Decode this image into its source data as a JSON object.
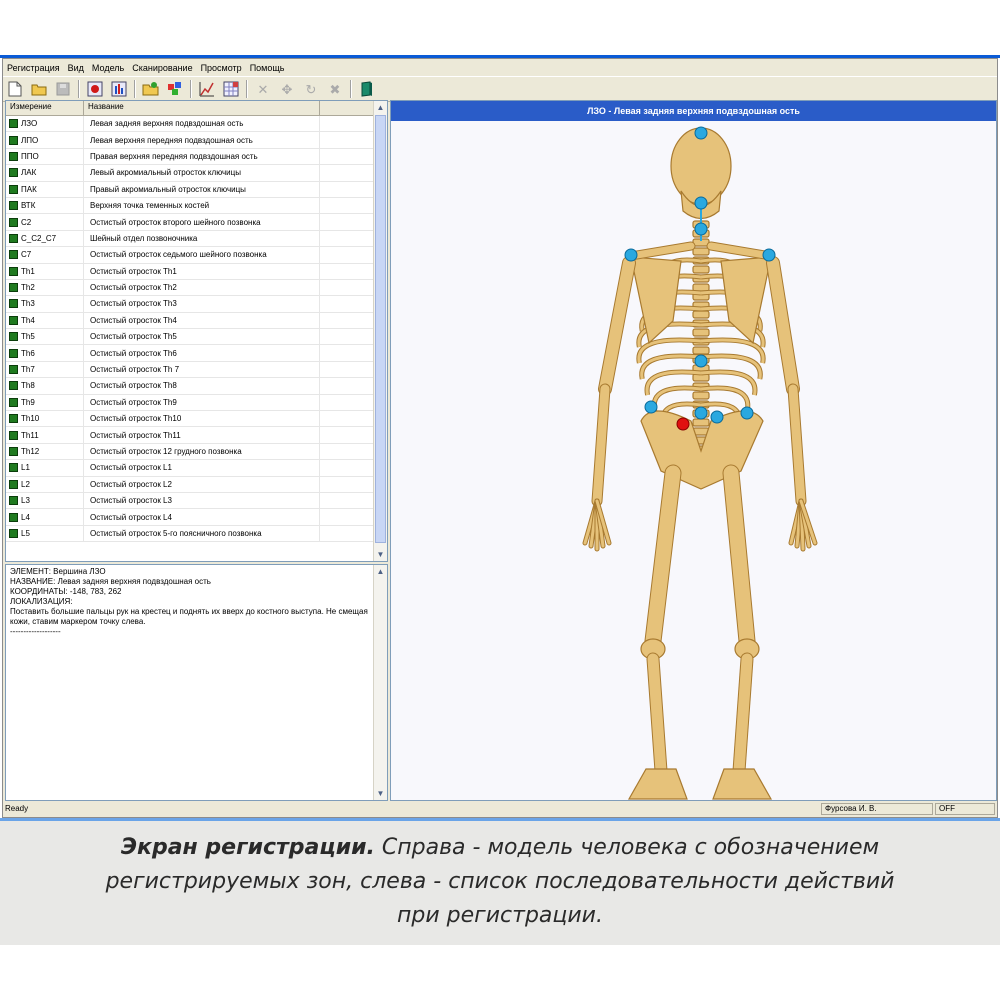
{
  "menu": [
    "Регистрация",
    "Вид",
    "Модель",
    "Сканирование",
    "Просмотр",
    "Помощь"
  ],
  "list": {
    "headers": [
      "Измерение",
      "Название"
    ],
    "rows": [
      [
        "ЛЗО",
        "Левая задняя верхняя подвздошная ость"
      ],
      [
        "ЛПО",
        "Левая верхняя передняя подвздошная ость"
      ],
      [
        "ППО",
        "Правая верхняя передняя подвздошная ость"
      ],
      [
        "ЛАК",
        "Левый акромиальный отросток  ключицы"
      ],
      [
        "ПАК",
        "Правый акромиальный отросток  ключицы"
      ],
      [
        "ВТК",
        "Верхняя точка теменных костей"
      ],
      [
        "C2",
        "Остистый отросток второго шейного позвонка"
      ],
      [
        "C_C2_C7",
        "Шейный отдел позвоночника"
      ],
      [
        "C7",
        "Остистый отросток седьмого шейного позвонка"
      ],
      [
        "Th1",
        "Остистый отросток Th1"
      ],
      [
        "Th2",
        "Остистый отросток Th2"
      ],
      [
        "Th3",
        "Остистый отросток Th3"
      ],
      [
        "Th4",
        "Остистый отросток Th4"
      ],
      [
        "Th5",
        "Остистый отросток Th5"
      ],
      [
        "Th6",
        "Остистый отросток Th6"
      ],
      [
        "Th7",
        "Остистый отросток Th 7"
      ],
      [
        "Th8",
        "Остистый отросток Th8"
      ],
      [
        "Th9",
        "Остистый отросток Th9"
      ],
      [
        "Th10",
        "Остистый отросток Th10"
      ],
      [
        "Th11",
        "Остистый отросток Th11"
      ],
      [
        "Th12",
        "Остистый отросток 12 грудного позвонка"
      ],
      [
        "L1",
        "Остистый отросток L1"
      ],
      [
        "L2",
        "Остистый отросток L2"
      ],
      [
        "L3",
        "Остистый отросток L3"
      ],
      [
        "L4",
        "Остистый отросток L4"
      ],
      [
        "L5",
        "Остистый отросток 5-го поясничного позвонка"
      ]
    ]
  },
  "info": {
    "element": "ЭЛЕМЕНТ: Вершина ЛЗО",
    "name": "НАЗВАНИЕ: Левая задняя верхняя подвздошная ость",
    "coords": "КООРДИНАТЫ: -148, 783, 262",
    "localization_label": "ЛОКАЛИЗАЦИЯ:",
    "localization_text": "Поставить большие пальцы рук на крестец и поднять  их вверх до костного выступа. Не смещая кожи, ставим маркером точку слева.",
    "separator": "-------------------"
  },
  "model": {
    "title": "ЛЗО - Левая задняя верхняя подвздошная ость",
    "marker_color": "#2aa8e0",
    "active_color": "#e01010",
    "bone_color": "#e6c27a"
  },
  "status": {
    "ready": "Ready",
    "user": "Фурсова И. В.",
    "mode": "OFF"
  },
  "caption": {
    "bold": "Экран регистрации.",
    "line1": "Справа - модель человека с обозначением",
    "line2": "регистрируемых зон, слева - список последовательности действий",
    "line3": "при регистрации."
  },
  "icons": [
    "new-file-icon",
    "open-folder-icon",
    "save-icon",
    "record-icon",
    "chart-icon",
    "scan-icon",
    "palette-icon",
    "graph-icon",
    "grid-icon",
    "cross-icon",
    "move-icon",
    "rotate-icon",
    "close-icon",
    "book-icon"
  ]
}
